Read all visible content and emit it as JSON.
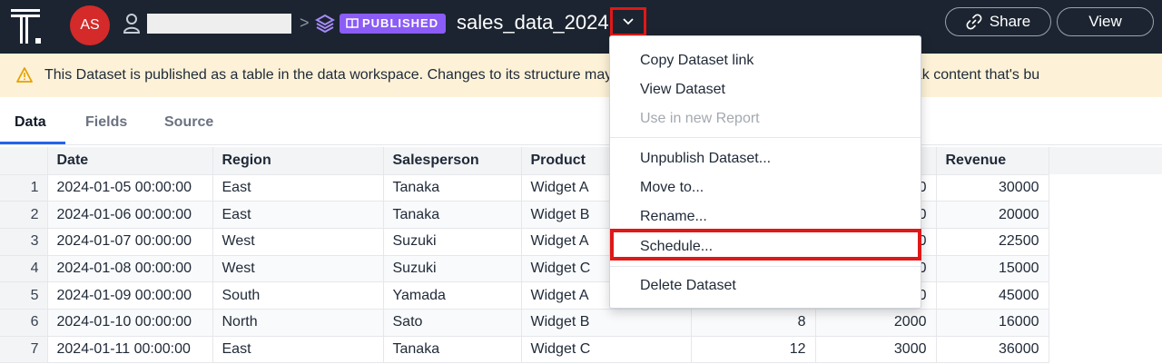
{
  "header": {
    "avatar_initials": "AS",
    "breadcrumb_sep": ">",
    "badge_label": "PUBLISHED",
    "dataset_title": "sales_data_2024",
    "share_label": "Share",
    "view_label": "View"
  },
  "banner": {
    "text": "This Dataset is published as a table in the data workspace. Changes to its structure may break content that uses this table and may break content that's bu"
  },
  "tabs": [
    "Data",
    "Fields",
    "Source"
  ],
  "table": {
    "columns": [
      "Date",
      "Region",
      "Salesperson",
      "Product",
      "",
      "",
      "Revenue"
    ],
    "rows": [
      [
        "1",
        "2024-01-05 00:00:00",
        "East",
        "Tanaka",
        "Widget A",
        "",
        "0",
        "30000"
      ],
      [
        "2",
        "2024-01-06 00:00:00",
        "East",
        "Tanaka",
        "Widget B",
        "",
        "0",
        "20000"
      ],
      [
        "3",
        "2024-01-07 00:00:00",
        "West",
        "Suzuki",
        "Widget A",
        "",
        "0",
        "22500"
      ],
      [
        "4",
        "2024-01-08 00:00:00",
        "West",
        "Suzuki",
        "Widget C",
        "",
        "0",
        "15000"
      ],
      [
        "5",
        "2024-01-09 00:00:00",
        "South",
        "Yamada",
        "Widget A",
        "",
        "0",
        "45000"
      ],
      [
        "6",
        "2024-01-10 00:00:00",
        "North",
        "Sato",
        "Widget B",
        "8",
        "2000",
        "16000"
      ],
      [
        "7",
        "2024-01-11 00:00:00",
        "East",
        "Tanaka",
        "Widget C",
        "12",
        "3000",
        "36000"
      ]
    ]
  },
  "menu": {
    "copy_link": "Copy Dataset link",
    "view_dataset": "View Dataset",
    "use_in_report": "Use in new Report",
    "unpublish": "Unpublish Dataset...",
    "move_to": "Move to...",
    "rename": "Rename...",
    "schedule": "Schedule...",
    "delete": "Delete Dataset"
  },
  "colors": {
    "topbar": "#1b2430",
    "badge": "#8b5cf6",
    "avatar": "#d42a2a",
    "banner": "#fdf2d7",
    "highlight": "#e01818",
    "tab_accent": "#2563eb"
  },
  "icons": [
    "logo-icon",
    "user-icon",
    "layers-icon",
    "book-icon",
    "chevron-down-icon",
    "link-icon",
    "warning-icon"
  ]
}
